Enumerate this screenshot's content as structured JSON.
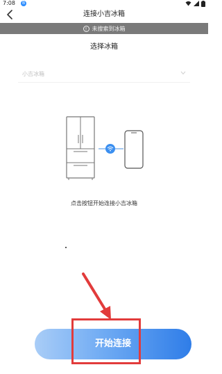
{
  "status_bar": {
    "time": "7:08",
    "notification_badge": "B"
  },
  "header": {
    "title": "连接小吉冰箱",
    "back_icon": "chevron-left-icon"
  },
  "notice": {
    "icon": "info-icon",
    "icon_glyph": "!",
    "text": "未搜索到冰箱"
  },
  "section": {
    "title": "选择冰箱"
  },
  "select": {
    "value": "小吉冰箱",
    "icon": "chevron-down-icon"
  },
  "illustration": {
    "fridge_icon": "fridge-icon",
    "wifi_icon": "wifi-icon",
    "phone_icon": "phone-icon"
  },
  "instruction": {
    "text": "点击按钮开始连接小吉冰箱"
  },
  "action": {
    "start_label": "开始连接"
  },
  "colors": {
    "notice_bg": "#7a7a7a",
    "accent_blue": "#2f7de8",
    "annotation_red": "#e23b3b"
  }
}
